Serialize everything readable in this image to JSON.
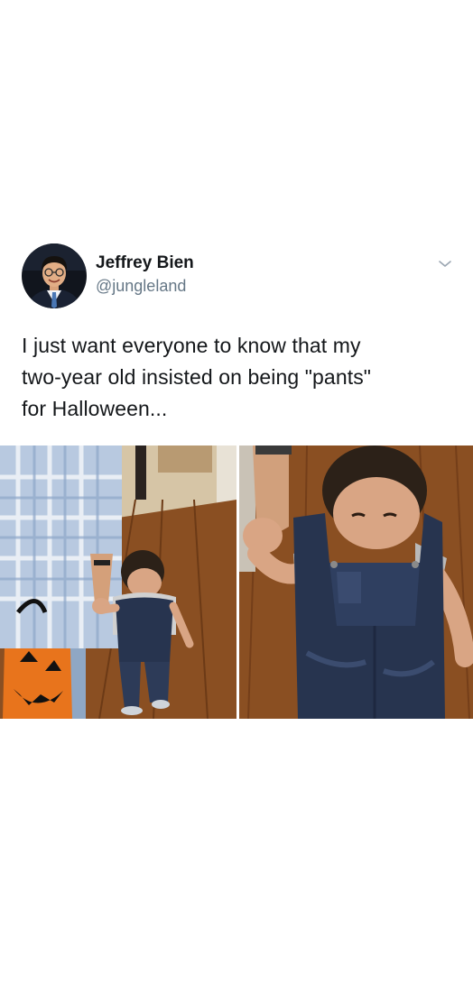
{
  "tweet": {
    "author": {
      "name": "Jeffrey Bien",
      "handle": "@jungleland",
      "avatar_icon": "profile-photo"
    },
    "menu_icon": "chevron-down-icon",
    "text": "I just want everyone to know that my\ntwo-year old insisted on being \"pants\"\nfor Halloween...",
    "media": [
      {
        "icon": "photo-toddler-walking-hallway"
      },
      {
        "icon": "photo-toddler-closeup-overalls"
      }
    ]
  },
  "colors": {
    "background": "#ffffff",
    "text": "#14171a",
    "secondary_text": "#657786",
    "floor": "#8a4f22",
    "denim": "#27344f",
    "pumpkin_bag": "#e8741c"
  }
}
